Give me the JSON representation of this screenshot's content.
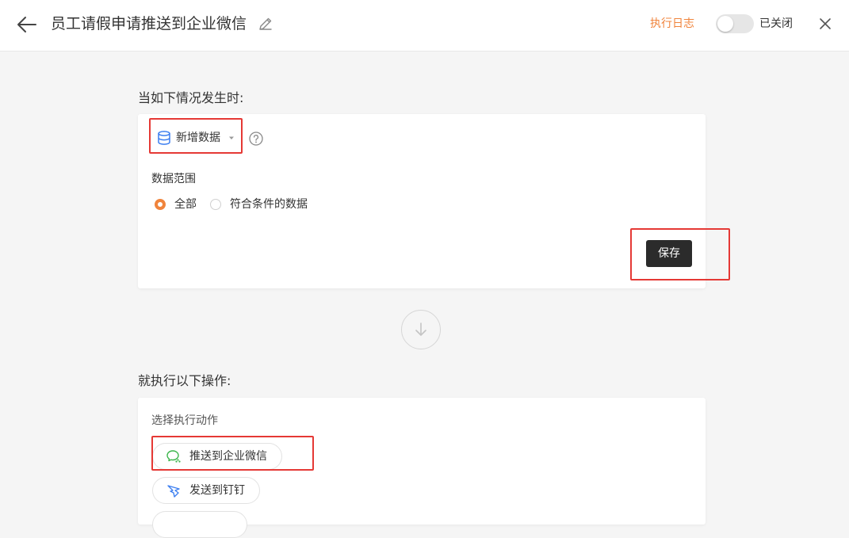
{
  "header": {
    "title": "员工请假申请推送到企业微信",
    "log_link": "执行日志",
    "toggle_label": "已关闭",
    "toggle_on": false,
    "accent_color": "#f0843c"
  },
  "trigger": {
    "section_title": "当如下情况发生时:",
    "event_label": "新增数据",
    "event_icon": "database-icon",
    "range_label": "数据范围",
    "range_options": [
      {
        "label": "全部",
        "checked": true
      },
      {
        "label": "符合条件的数据",
        "checked": false
      }
    ],
    "save_label": "保存"
  },
  "actions": {
    "section_title": "就执行以下操作:",
    "select_label": "选择执行动作",
    "items": [
      {
        "label": "推送到企业微信",
        "icon": "wecom-icon"
      },
      {
        "label": "发送到钉钉",
        "icon": "dingtalk-icon"
      }
    ]
  },
  "highlight_color": "#e53935"
}
